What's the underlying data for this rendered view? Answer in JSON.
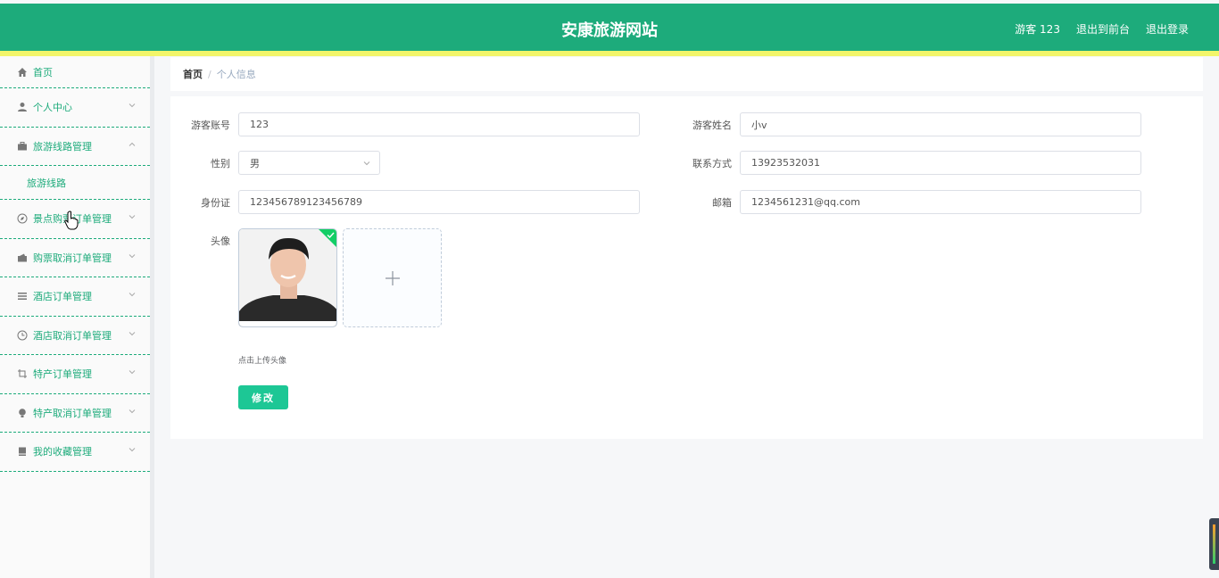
{
  "header": {
    "title": "安康旅游网站",
    "user": "游客 123",
    "to_front": "退出到前台",
    "logout": "退出登录"
  },
  "sidebar": {
    "items": [
      {
        "label": "首页",
        "icon": "home-icon"
      },
      {
        "label": "个人中心",
        "icon": "user-icon"
      },
      {
        "label": "旅游线路管理",
        "icon": "briefcase-icon",
        "expanded": true,
        "sub": [
          "旅游线路"
        ]
      },
      {
        "label": "景点购票订单管理",
        "icon": "compass-icon"
      },
      {
        "label": "购票取消订单管理",
        "icon": "wallet-icon"
      },
      {
        "label": "酒店订单管理",
        "icon": "list-icon"
      },
      {
        "label": "酒店取消订单管理",
        "icon": "clock-icon"
      },
      {
        "label": "特产订单管理",
        "icon": "crop-icon"
      },
      {
        "label": "特产取消订单管理",
        "icon": "bulb-icon"
      },
      {
        "label": "我的收藏管理",
        "icon": "bookmark-icon"
      }
    ]
  },
  "breadcrumb": {
    "home": "首页",
    "sep": "/",
    "current": "个人信息"
  },
  "form": {
    "account_label": "游客账号",
    "account_value": "123",
    "name_label": "游客姓名",
    "name_value": "小v",
    "gender_label": "性别",
    "gender_value": "男",
    "phone_label": "联系方式",
    "phone_value": "13923532031",
    "idcard_label": "身份证",
    "idcard_value": "123456789123456789",
    "email_label": "邮箱",
    "email_value": "1234561231@qq.com",
    "avatar_label": "头像",
    "upload_tip": "点击上传头像",
    "submit": "修改"
  },
  "colors": {
    "primary": "#1dab7b",
    "stripe": "#f2f56a",
    "button": "#1dc795"
  }
}
